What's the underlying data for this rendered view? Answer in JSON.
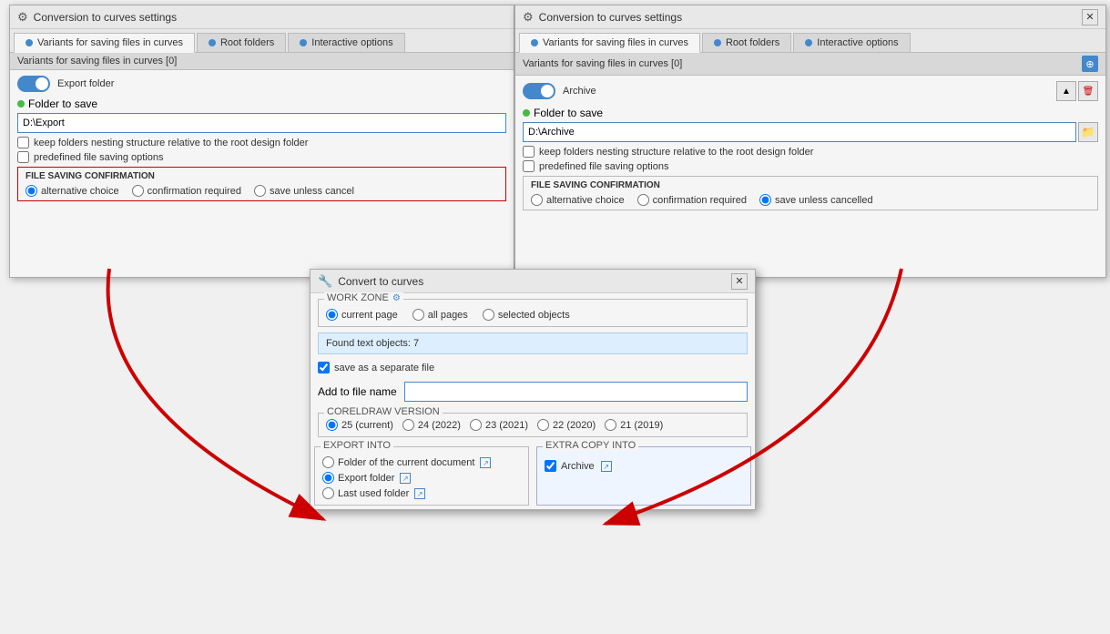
{
  "window1": {
    "title": "Conversion to curves settings",
    "tabs": [
      {
        "label": "Variants for saving files in curves",
        "active": true
      },
      {
        "label": "Root folders",
        "active": false
      },
      {
        "label": "Interactive options",
        "active": false
      }
    ],
    "section_header": "Variants for saving files in curves [0]",
    "toggle_label": "Export folder",
    "folder_label": "Folder to save",
    "folder_value": "D:\\Export",
    "checkbox1": "keep folders nesting structure relative to the root design folder",
    "checkbox2": "predefined file saving options",
    "confirmation_label": "FILE SAVING CONFIRMATION",
    "radio_options": [
      "alternative choice",
      "confirmation required",
      "save unless cancel"
    ],
    "selected_radio": 0
  },
  "window2": {
    "title": "Conversion to curves settings",
    "tabs": [
      {
        "label": "Variants for saving files in curves",
        "active": true
      },
      {
        "label": "Root folders",
        "active": false
      },
      {
        "label": "Interactive options",
        "active": false
      }
    ],
    "section_header": "Variants for saving files in curves [0]",
    "toggle_label": "Archive",
    "folder_label": "Folder to save",
    "folder_value": "D:\\Archive",
    "checkbox1": "keep folders nesting structure relative to the root design folder",
    "checkbox2": "predefined file saving options",
    "confirmation_label": "FILE SAVING CONFIRMATION",
    "radio_options": [
      "alternative choice",
      "confirmation required",
      "save unless cancelled"
    ],
    "selected_radio": 2
  },
  "dialog": {
    "title": "Convert to curves",
    "workzone_label": "WORK ZONE",
    "work_options": [
      "current page",
      "all pages",
      "selected objects"
    ],
    "work_selected": 0,
    "found_text": "Found text objects: 7",
    "save_separate": "save as a separate file",
    "add_to_name_label": "Add to file name",
    "add_to_name_value": "",
    "corel_label": "CORELDRAW VERSION",
    "corel_versions": [
      "25 (current)",
      "24 (2022)",
      "23 (2021)",
      "22 (2020)",
      "21 (2019)"
    ],
    "corel_selected": 0,
    "export_into_label": "EXPORT INTO",
    "export_options": [
      "Folder of the current document",
      "Export folder",
      "Last used folder"
    ],
    "export_selected": 1,
    "extra_copy_label": "EXTRA COPY INTO",
    "extra_archive": "Archive",
    "extra_checked": true
  }
}
